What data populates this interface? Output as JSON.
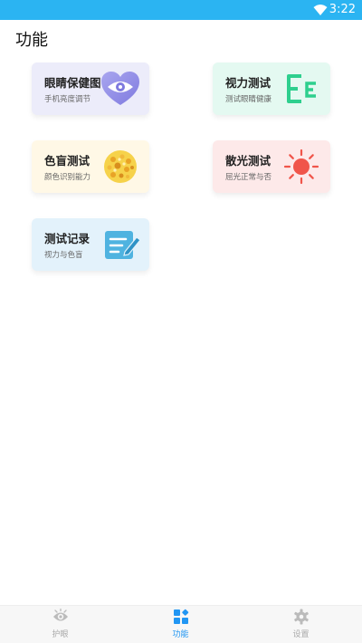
{
  "status_bar": {
    "time": "3:22",
    "icon": "wifi-icon"
  },
  "page": {
    "title": "功能"
  },
  "cards": [
    {
      "title": "眼睛保健图",
      "subtitle": "手机亮度调节",
      "icon": "heart-eye-icon"
    },
    {
      "title": "视力测试",
      "subtitle": "测试眼睛健康",
      "icon": "e-chart-icon"
    },
    {
      "title": "色盲测试",
      "subtitle": "颜色识别能力",
      "icon": "color-dots-icon"
    },
    {
      "title": "散光测试",
      "subtitle": "屈光正常与否",
      "icon": "sun-icon"
    },
    {
      "title": "测试记录",
      "subtitle": "视力与色盲",
      "icon": "note-edit-icon"
    }
  ],
  "bottom_nav": [
    {
      "label": "护眼",
      "icon": "eye-icon",
      "active": false
    },
    {
      "label": "功能",
      "icon": "grid-icon",
      "active": true
    },
    {
      "label": "设置",
      "icon": "gear-icon",
      "active": false
    }
  ],
  "colors": {
    "status_bar": "#2bb4f2",
    "active_tab": "#2196f3",
    "inactive_tab": "#aaaaaa"
  }
}
